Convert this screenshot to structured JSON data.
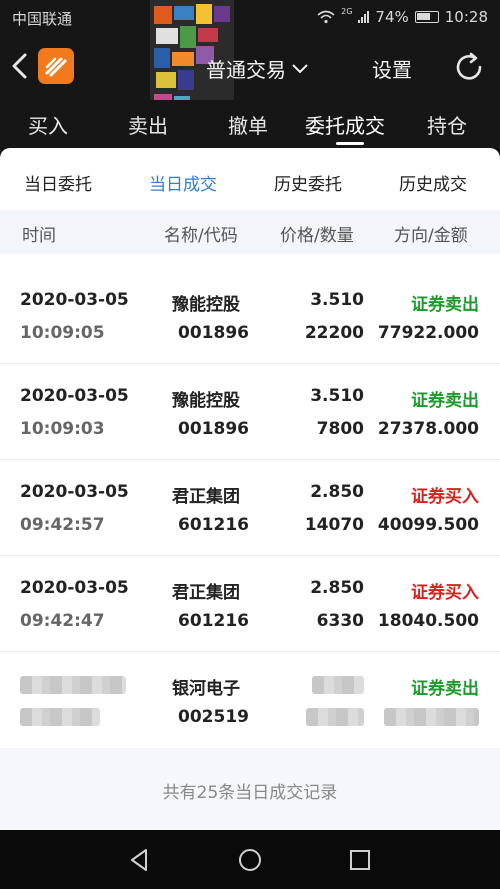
{
  "status": {
    "carrier": "中国联通",
    "network": "2G",
    "battery": "74%",
    "time": "10:28"
  },
  "header": {
    "title": "普通交易",
    "settings": "设置",
    "icons": [
      "back-icon",
      "app-logo",
      "chevron-down-icon",
      "refresh-icon"
    ]
  },
  "main_tabs": [
    "买入",
    "卖出",
    "撤单",
    "委托成交",
    "持仓"
  ],
  "main_tab_active": 3,
  "sub_tabs": [
    "当日委托",
    "当日成交",
    "历史委托",
    "历史成交"
  ],
  "sub_tab_active": 1,
  "columns": [
    "时间",
    "名称/代码",
    "价格/数量",
    "方向/金额"
  ],
  "trades": [
    {
      "date": "2020-03-05",
      "time": "10:09:05",
      "name": "豫能控股",
      "code": "001896",
      "price": "3.510",
      "qty": "22200",
      "direction": "证券卖出",
      "amount": "77922.000"
    },
    {
      "date": "2020-03-05",
      "time": "10:09:03",
      "name": "豫能控股",
      "code": "001896",
      "price": "3.510",
      "qty": "7800",
      "direction": "证券卖出",
      "amount": "27378.000"
    },
    {
      "date": "2020-03-05",
      "time": "09:42:57",
      "name": "君正集团",
      "code": "601216",
      "price": "2.850",
      "qty": "14070",
      "direction": "证券买入",
      "amount": "40099.500"
    },
    {
      "date": "2020-03-05",
      "time": "09:42:47",
      "name": "君正集团",
      "code": "601216",
      "price": "2.850",
      "qty": "6330",
      "direction": "证券买入",
      "amount": "18040.500"
    },
    {
      "name": "银河电子",
      "code": "002519",
      "direction": "证券卖出"
    }
  ],
  "footer": "共有25条当日成交记录",
  "colors": {
    "accent": "#2f7fd4",
    "sell": "#1e9a2c",
    "buy": "#d72222",
    "logo": "#f07a1c"
  }
}
